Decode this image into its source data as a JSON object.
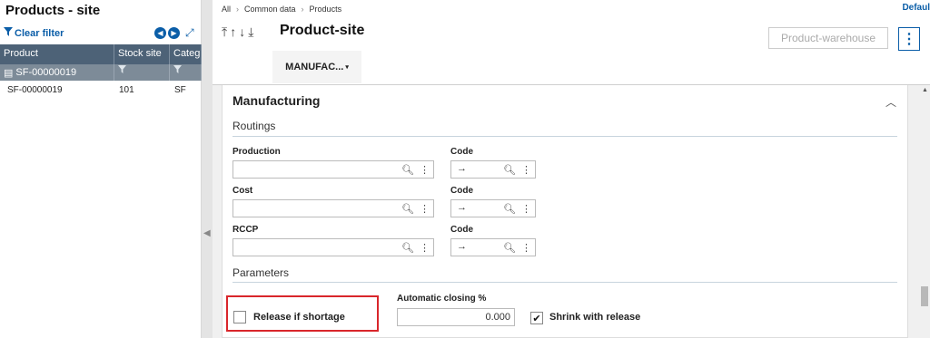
{
  "left_panel": {
    "title": "Products - site",
    "clear_filter_label": "Clear filter",
    "columns": [
      "Product",
      "Stock site",
      "Categ"
    ],
    "filter_row_value": "SF-00000019",
    "rows": [
      {
        "product": "SF-00000019",
        "stock_site": "101",
        "category": "SF"
      }
    ]
  },
  "breadcrumb": [
    "All",
    "Common data",
    "Products"
  ],
  "default_link": "Defaul",
  "page_title": "Product-site",
  "product_warehouse_button": "Product-warehouse",
  "kebab_glyph": "⋮",
  "tab_label": "MANUFAC...",
  "section": {
    "title": "Manufacturing",
    "routings_label": "Routings",
    "parameters_label": "Parameters"
  },
  "fields": {
    "production_label": "Production",
    "cost_label": "Cost",
    "rccp_label": "RCCP",
    "code_label": "Code",
    "code_arrow": "→",
    "auto_closing_label": "Automatic closing %",
    "auto_closing_value": "0.000",
    "release_shortage_label": "Release if shortage",
    "release_shortage_checked": false,
    "shrink_release_label": "Shrink with release",
    "shrink_release_checked": true,
    "checkmark": "✔"
  },
  "icons": {
    "search": "search-icon",
    "more": "more-vert-icon"
  },
  "colors": {
    "accent": "#0b5ea8",
    "grid_header": "#4d6277",
    "highlight": "#d9262b"
  }
}
